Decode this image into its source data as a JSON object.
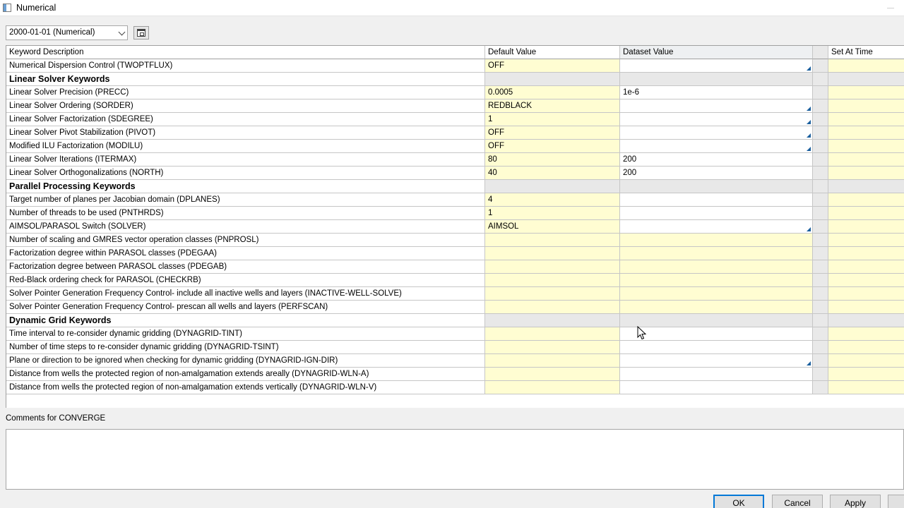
{
  "window": {
    "title": "Numerical"
  },
  "toolbar": {
    "dataset_selected": "2000-01-01 (Numerical)"
  },
  "grid": {
    "columns": {
      "description": "Keyword Description",
      "default": "Default Value",
      "dataset": "Dataset Value",
      "set_at": "Set At Time"
    },
    "rows": [
      {
        "type": "data",
        "desc": "Numerical Dispersion Control (TWOPTFLUX)",
        "default": "OFF",
        "dataset": "",
        "dropdown": true
      },
      {
        "type": "section",
        "desc": "Linear Solver Keywords"
      },
      {
        "type": "data",
        "desc": "Linear Solver Precision (PRECC)",
        "default": "0.0005",
        "dataset": "1e-6",
        "dropdown": false
      },
      {
        "type": "data",
        "desc": "Linear Solver Ordering (SORDER)",
        "default": "REDBLACK",
        "dataset": "",
        "dropdown": true
      },
      {
        "type": "data",
        "desc": "Linear Solver Factorization (SDEGREE)",
        "default": "1",
        "dataset": "",
        "dropdown": true
      },
      {
        "type": "data",
        "desc": "Linear Solver Pivot Stabilization (PIVOT)",
        "default": "OFF",
        "dataset": "",
        "dropdown": true
      },
      {
        "type": "data",
        "desc": "Modified ILU Factorization (MODILU)",
        "default": "OFF",
        "dataset": "",
        "dropdown": true
      },
      {
        "type": "data",
        "desc": "Linear Solver Iterations (ITERMAX)",
        "default": "80",
        "dataset": "200",
        "dropdown": false
      },
      {
        "type": "data",
        "desc": "Linear Solver Orthogonalizations (NORTH)",
        "default": "40",
        "dataset": "200",
        "dropdown": false
      },
      {
        "type": "section",
        "desc": "Parallel Processing Keywords"
      },
      {
        "type": "data",
        "desc": "Target number of planes per Jacobian domain (DPLANES)",
        "default": "4",
        "dataset": "",
        "dropdown": false
      },
      {
        "type": "data",
        "desc": "Number of threads to be used (PNTHRDS)",
        "default": "1",
        "dataset": "",
        "dropdown": false
      },
      {
        "type": "data",
        "desc": "AIMSOL/PARASOL Switch (SOLVER)",
        "default": "AIMSOL",
        "dataset": "",
        "dropdown": true
      },
      {
        "type": "data",
        "desc": "Number of scaling and GMRES vector operation classes (PNPROSL)",
        "default": "",
        "dataset": "",
        "dropdown": false,
        "yellow_ds": true
      },
      {
        "type": "data",
        "desc": "Factorization degree within PARASOL classes (PDEGAA)",
        "default": "",
        "dataset": "",
        "dropdown": false,
        "yellow_ds": true
      },
      {
        "type": "data",
        "desc": "Factorization degree between PARASOL classes (PDEGAB)",
        "default": "",
        "dataset": "",
        "dropdown": false,
        "yellow_ds": true
      },
      {
        "type": "data",
        "desc": "Red-Black ordering check for PARASOL (CHECKRB)",
        "default": "",
        "dataset": "",
        "dropdown": false,
        "yellow_ds": true
      },
      {
        "type": "data",
        "desc": "Solver Pointer Generation Frequency Control- include all inactive wells and layers (INACTIVE-WELL-SOLVE)",
        "default": "",
        "dataset": "",
        "dropdown": false,
        "yellow_ds": true
      },
      {
        "type": "data",
        "desc": "Solver Pointer Generation Frequency Control- prescan all wells and layers (PERFSCAN)",
        "default": "",
        "dataset": "",
        "dropdown": false,
        "yellow_ds": true
      },
      {
        "type": "section",
        "desc": "Dynamic Grid Keywords"
      },
      {
        "type": "data",
        "desc": "Time interval to re-consider dynamic gridding (DYNAGRID-TINT)",
        "default": "",
        "dataset": "",
        "dropdown": false
      },
      {
        "type": "data",
        "desc": "Number of time steps to re-consider dynamic gridding (DYNAGRID-TSINT)",
        "default": "",
        "dataset": "",
        "dropdown": false
      },
      {
        "type": "data",
        "desc": "Plane or direction to be ignored when checking for dynamic gridding (DYNAGRID-IGN-DIR)",
        "default": "",
        "dataset": "",
        "dropdown": true
      },
      {
        "type": "data",
        "desc": "Distance from wells the protected region of non-amalgamation extends areally (DYNAGRID-WLN-A)",
        "default": "",
        "dataset": "",
        "dropdown": false
      },
      {
        "type": "data",
        "desc": "Distance from wells the protected region of non-amalgamation extends vertically (DYNAGRID-WLN-V)",
        "default": "",
        "dataset": "",
        "dropdown": false
      }
    ]
  },
  "comments": {
    "label": "Comments for CONVERGE",
    "value": ""
  },
  "buttons": {
    "ok": "OK",
    "cancel": "Cancel",
    "apply": "Apply"
  }
}
